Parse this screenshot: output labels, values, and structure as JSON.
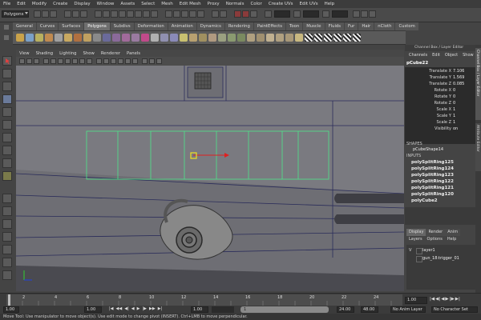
{
  "menubar": [
    "File",
    "Edit",
    "Modify",
    "Create",
    "Display",
    "Window",
    "Assets",
    "Select",
    "Mesh",
    "Edit Mesh",
    "Proxy",
    "Normals",
    "Color",
    "Create UVs",
    "Edit UVs",
    "Help"
  ],
  "status": {
    "mode": "Polygons"
  },
  "shelf": {
    "tabs": [
      "General",
      "Curves",
      "Surfaces",
      "Polygons",
      "Subdivs",
      "Deformation",
      "Animation",
      "Dynamics",
      "Rendering",
      "PaintEffects",
      "Toon",
      "Muscle",
      "Fluids",
      "Fur",
      "Hair",
      "nCloth",
      "Custom"
    ],
    "active_tab": "Polygons"
  },
  "viewport": {
    "menu": [
      "View",
      "Shading",
      "Lighting",
      "Show",
      "Renderer",
      "Panels"
    ]
  },
  "channel_box": {
    "title": "Channel Box / Layer Editor",
    "menu": [
      "Channels",
      "Edit",
      "Object",
      "Show"
    ],
    "object": "pCube22",
    "attributes": [
      {
        "label": "Translate X",
        "value": "7.106"
      },
      {
        "label": "Translate Y",
        "value": "1.569"
      },
      {
        "label": "Translate Z",
        "value": "0.085"
      },
      {
        "label": "Rotate X",
        "value": "0"
      },
      {
        "label": "Rotate Y",
        "value": "0"
      },
      {
        "label": "Rotate Z",
        "value": "0"
      },
      {
        "label": "Scale X",
        "value": "1"
      },
      {
        "label": "Scale Y",
        "value": "1"
      },
      {
        "label": "Scale Z",
        "value": "1"
      },
      {
        "label": "Visibility",
        "value": "on"
      }
    ],
    "shapes_header": "SHAPES",
    "shape": "pCubeShape14",
    "inputs_header": "INPUTS",
    "inputs": [
      "polySplitRing125",
      "polySplitRing124",
      "polySplitRing123",
      "polySplitRing122",
      "polySplitRing121",
      "polySplitRing120",
      "polyCube2"
    ]
  },
  "attr_strip": {
    "label1": "Channel Box / Layer Editor",
    "label2": "Attribute Editor"
  },
  "layer_editor": {
    "tabs": [
      "Display",
      "Render",
      "Anim"
    ],
    "menu": [
      "Layers",
      "Options",
      "Help"
    ],
    "layers": [
      {
        "vis": "V",
        "name": "layer1"
      },
      {
        "vis": "",
        "name": "gun_18:trigger_01"
      }
    ]
  },
  "timeline": {
    "ticks": [
      "2",
      "4",
      "6",
      "8",
      "10",
      "12",
      "14",
      "16",
      "18",
      "20",
      "22",
      "24"
    ],
    "current_frame": "1.00"
  },
  "range": {
    "start": "1.00",
    "inner_start": "1.00",
    "inner_current": "1.00",
    "range_label": "1",
    "end": "24.00",
    "max": "48.00",
    "anim_layer": "No Anim Layer",
    "char_set": "No Character Set"
  },
  "help": "Move Tool: Use manipulator to move object(s). Use edit mode to change pivot (INSERT). Ctrl+LMB to move perpendicular."
}
